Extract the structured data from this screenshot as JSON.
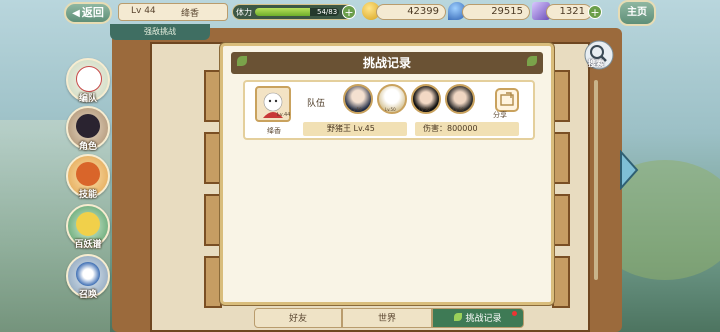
{
  "topbar": {
    "back_label": "返回",
    "level": "Lv 44",
    "player_name": "绛香",
    "sub_tab": "强敌挑战",
    "stamina_label": "体力",
    "stamina_value": "54/83",
    "stamina_fraction": 0.65,
    "coins": "42399",
    "gems": "29515",
    "crystals": "1321",
    "home_label": "主页"
  },
  "side_menu": [
    {
      "label": "编队"
    },
    {
      "label": "角色"
    },
    {
      "label": "技能"
    },
    {
      "label": "百妖谱"
    },
    {
      "label": "召唤"
    }
  ],
  "search_label": "搜索",
  "modal": {
    "title": "挑战记录",
    "record": {
      "player_name": "绛香",
      "player_level": "Lv.44",
      "team_label": "队伍",
      "heroes": [
        {
          "level": "Lv.50"
        },
        {
          "level": "Lv.50"
        },
        {
          "level": "Lv.50"
        },
        {
          "level": "Lv.50"
        }
      ],
      "share_label": "分享",
      "boss_info": "野猪王  Lv.45",
      "damage_info": "伤害：800000"
    }
  },
  "bottom_tabs": [
    {
      "label": "好友",
      "active": false
    },
    {
      "label": "世界",
      "active": false
    },
    {
      "label": "挑战记录",
      "active": true
    }
  ],
  "colors": {
    "accent_brown": "#6a5234",
    "active_green": "#3e7a55",
    "panel_cream": "#f9f4e6"
  }
}
